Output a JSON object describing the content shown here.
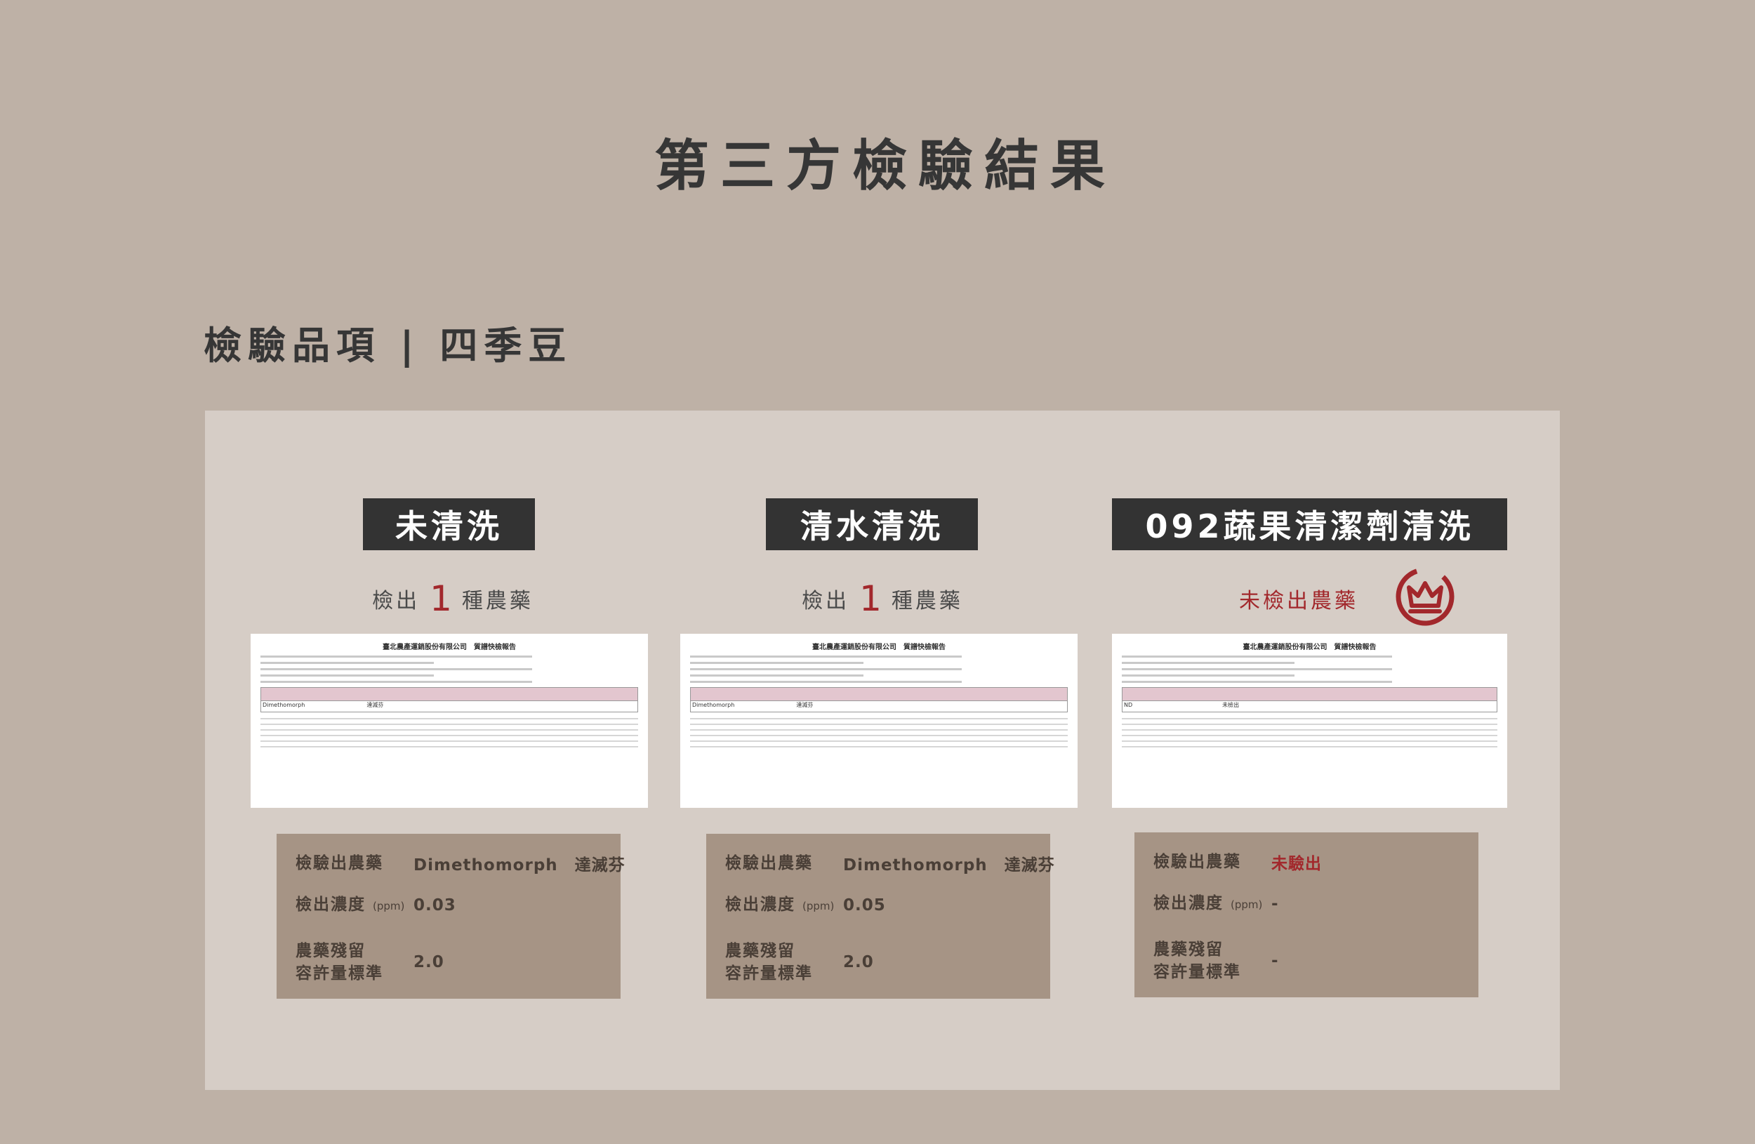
{
  "header": {
    "title": "第三方檢驗結果",
    "item_title": "檢驗品項 | 四季豆"
  },
  "columns": [
    {
      "label": "未清洗",
      "detect_prefix": "檢出",
      "detect_count": "1",
      "detect_suffix": "種農藥",
      "report": {
        "title": "臺北農產運銷股份有限公司　質譜快檢報告",
        "row_text": "Dimethomorph　　　　　　　　　　　達滅芬"
      },
      "info": {
        "pesticide_label": "檢驗出農藥",
        "pesticide_value": "Dimethomorph　達滅芬",
        "concentration_label": "檢出濃度",
        "concentration_unit": "(ppm)",
        "concentration_value": "0.03",
        "limit_label_1": "農藥殘留",
        "limit_label_2": "容許量標準",
        "limit_value": "2.0"
      }
    },
    {
      "label": "清水清洗",
      "detect_prefix": "檢出",
      "detect_count": "1",
      "detect_suffix": "種農藥",
      "report": {
        "title": "臺北農產運銷股份有限公司　質譜快檢報告",
        "row_text": "Dimethomorph　　　　　　　　　　　達滅芬"
      },
      "info": {
        "pesticide_label": "檢驗出農藥",
        "pesticide_value": "Dimethomorph　達滅芬",
        "concentration_label": "檢出濃度",
        "concentration_unit": "(ppm)",
        "concentration_value": "0.05",
        "limit_label_1": "農藥殘留",
        "limit_label_2": "容許量標準",
        "limit_value": "2.0"
      }
    },
    {
      "label": "092蔬果清潔劑清洗",
      "detect_text": "未檢出農藥",
      "report": {
        "title": "臺北農產運銷股份有限公司　質譜快檢報告",
        "row_text": "ND　　　　　　　　　　　　　　　　未檢出"
      },
      "info": {
        "pesticide_label": "檢驗出農藥",
        "pesticide_value": "未驗出",
        "concentration_label": "檢出濃度",
        "concentration_unit": "(ppm)",
        "concentration_value": "-",
        "limit_label_1": "農藥殘留",
        "limit_label_2": "容許量標準",
        "limit_value": "-"
      }
    }
  ],
  "colors": {
    "background": "#beb1a6",
    "panel": "#d6cdc6",
    "label_box": "#333333",
    "info_box": "#a69485",
    "accent_red": "#a2282c"
  },
  "icons": {
    "seal": "crown-seal-icon"
  }
}
